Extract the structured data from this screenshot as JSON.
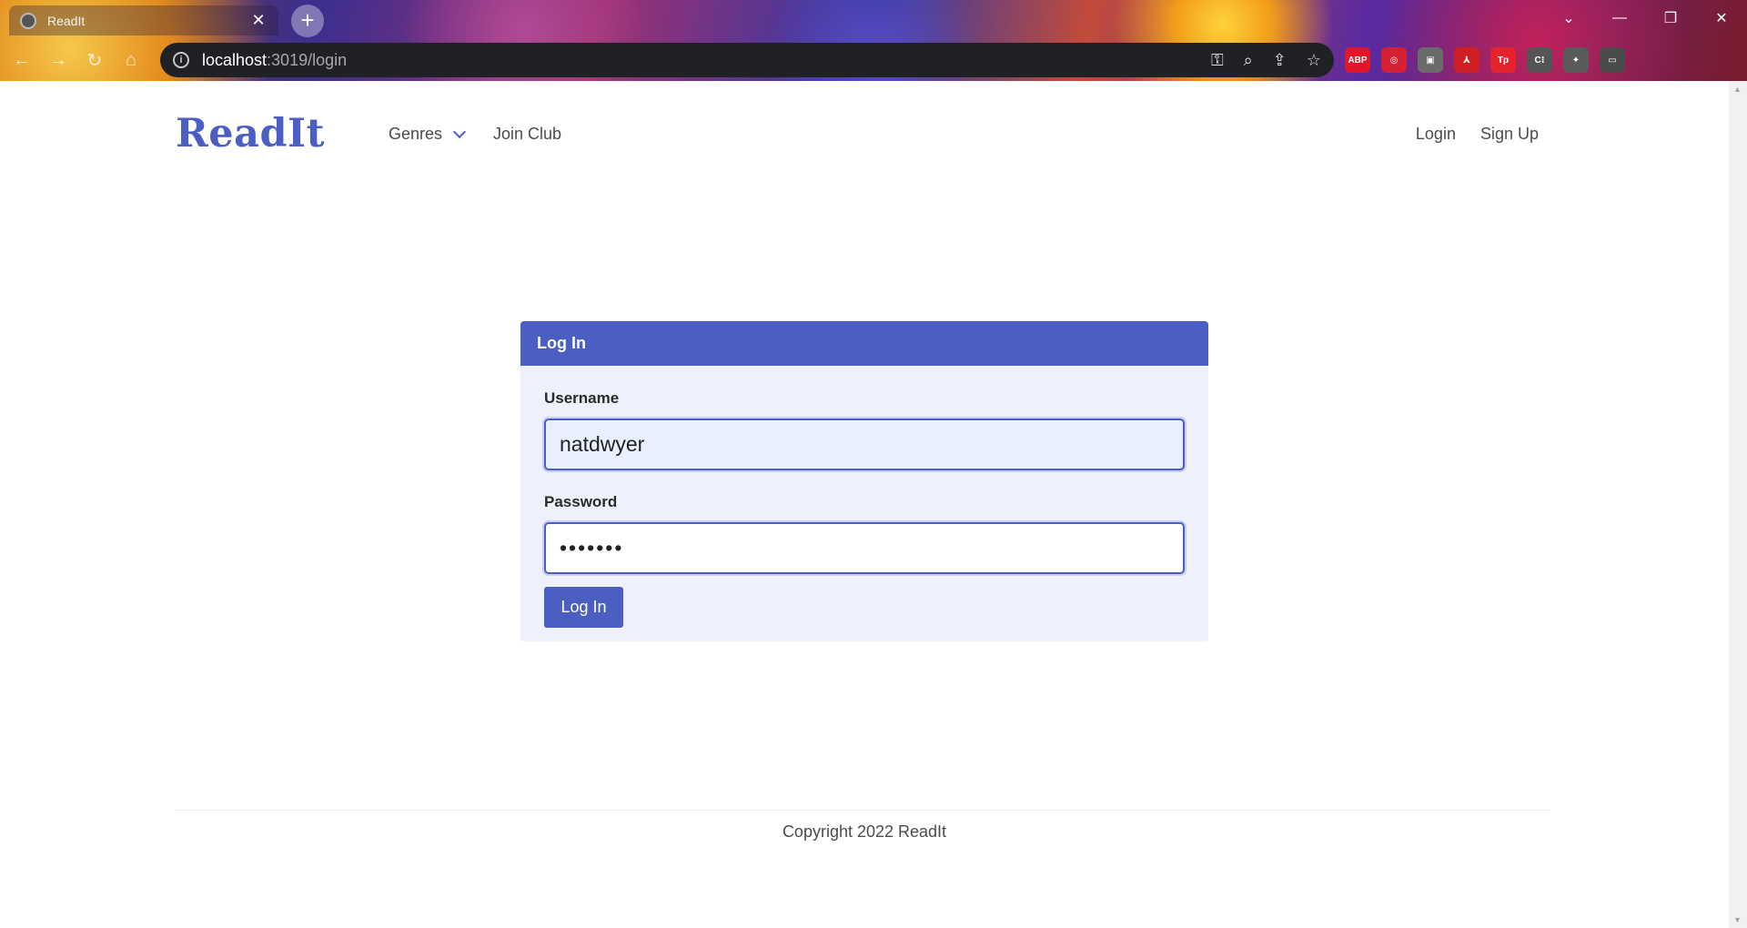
{
  "browser": {
    "tab_title": "ReadIt",
    "tab_close": "✕",
    "new_tab": "+",
    "url_host": "localhost",
    "url_path": ":3019/login",
    "window_controls": [
      "⌄",
      "—",
      "❐",
      "✕"
    ],
    "extensions": [
      {
        "name": "adblock-plus-icon",
        "label": "ABP",
        "color": "#e2162b"
      },
      {
        "name": "extension-red-icon",
        "label": "◎",
        "color": "#d41f35"
      },
      {
        "name": "extension-gray-icon",
        "label": "▣",
        "color": "#6b6b6b"
      },
      {
        "name": "acrobat-icon",
        "label": "⅄",
        "color": "#cf1f24"
      },
      {
        "name": "tp-icon",
        "label": "Tp",
        "color": "#e5232d"
      },
      {
        "name": "extension-c-icon",
        "label": "C⁝",
        "color": "#555555"
      },
      {
        "name": "puzzle-icon",
        "label": "✦",
        "color": "#5a5a5a"
      },
      {
        "name": "sidebar-icon",
        "label": "▭",
        "color": "#4b4b4b"
      }
    ]
  },
  "nav": {
    "brand": "ReadIt",
    "genres": "Genres",
    "join_club": "Join Club",
    "login": "Login",
    "signup": "Sign Up"
  },
  "form": {
    "header": "Log In",
    "username_label": "Username",
    "username_value": "natdwyer",
    "password_label": "Password",
    "password_value": "•••••••",
    "submit_label": "Log In"
  },
  "footer": {
    "copyright": "Copyright 2022 ReadIt"
  },
  "colors": {
    "primary": "#4a5ec4",
    "card_bg": "#eef0fb"
  }
}
